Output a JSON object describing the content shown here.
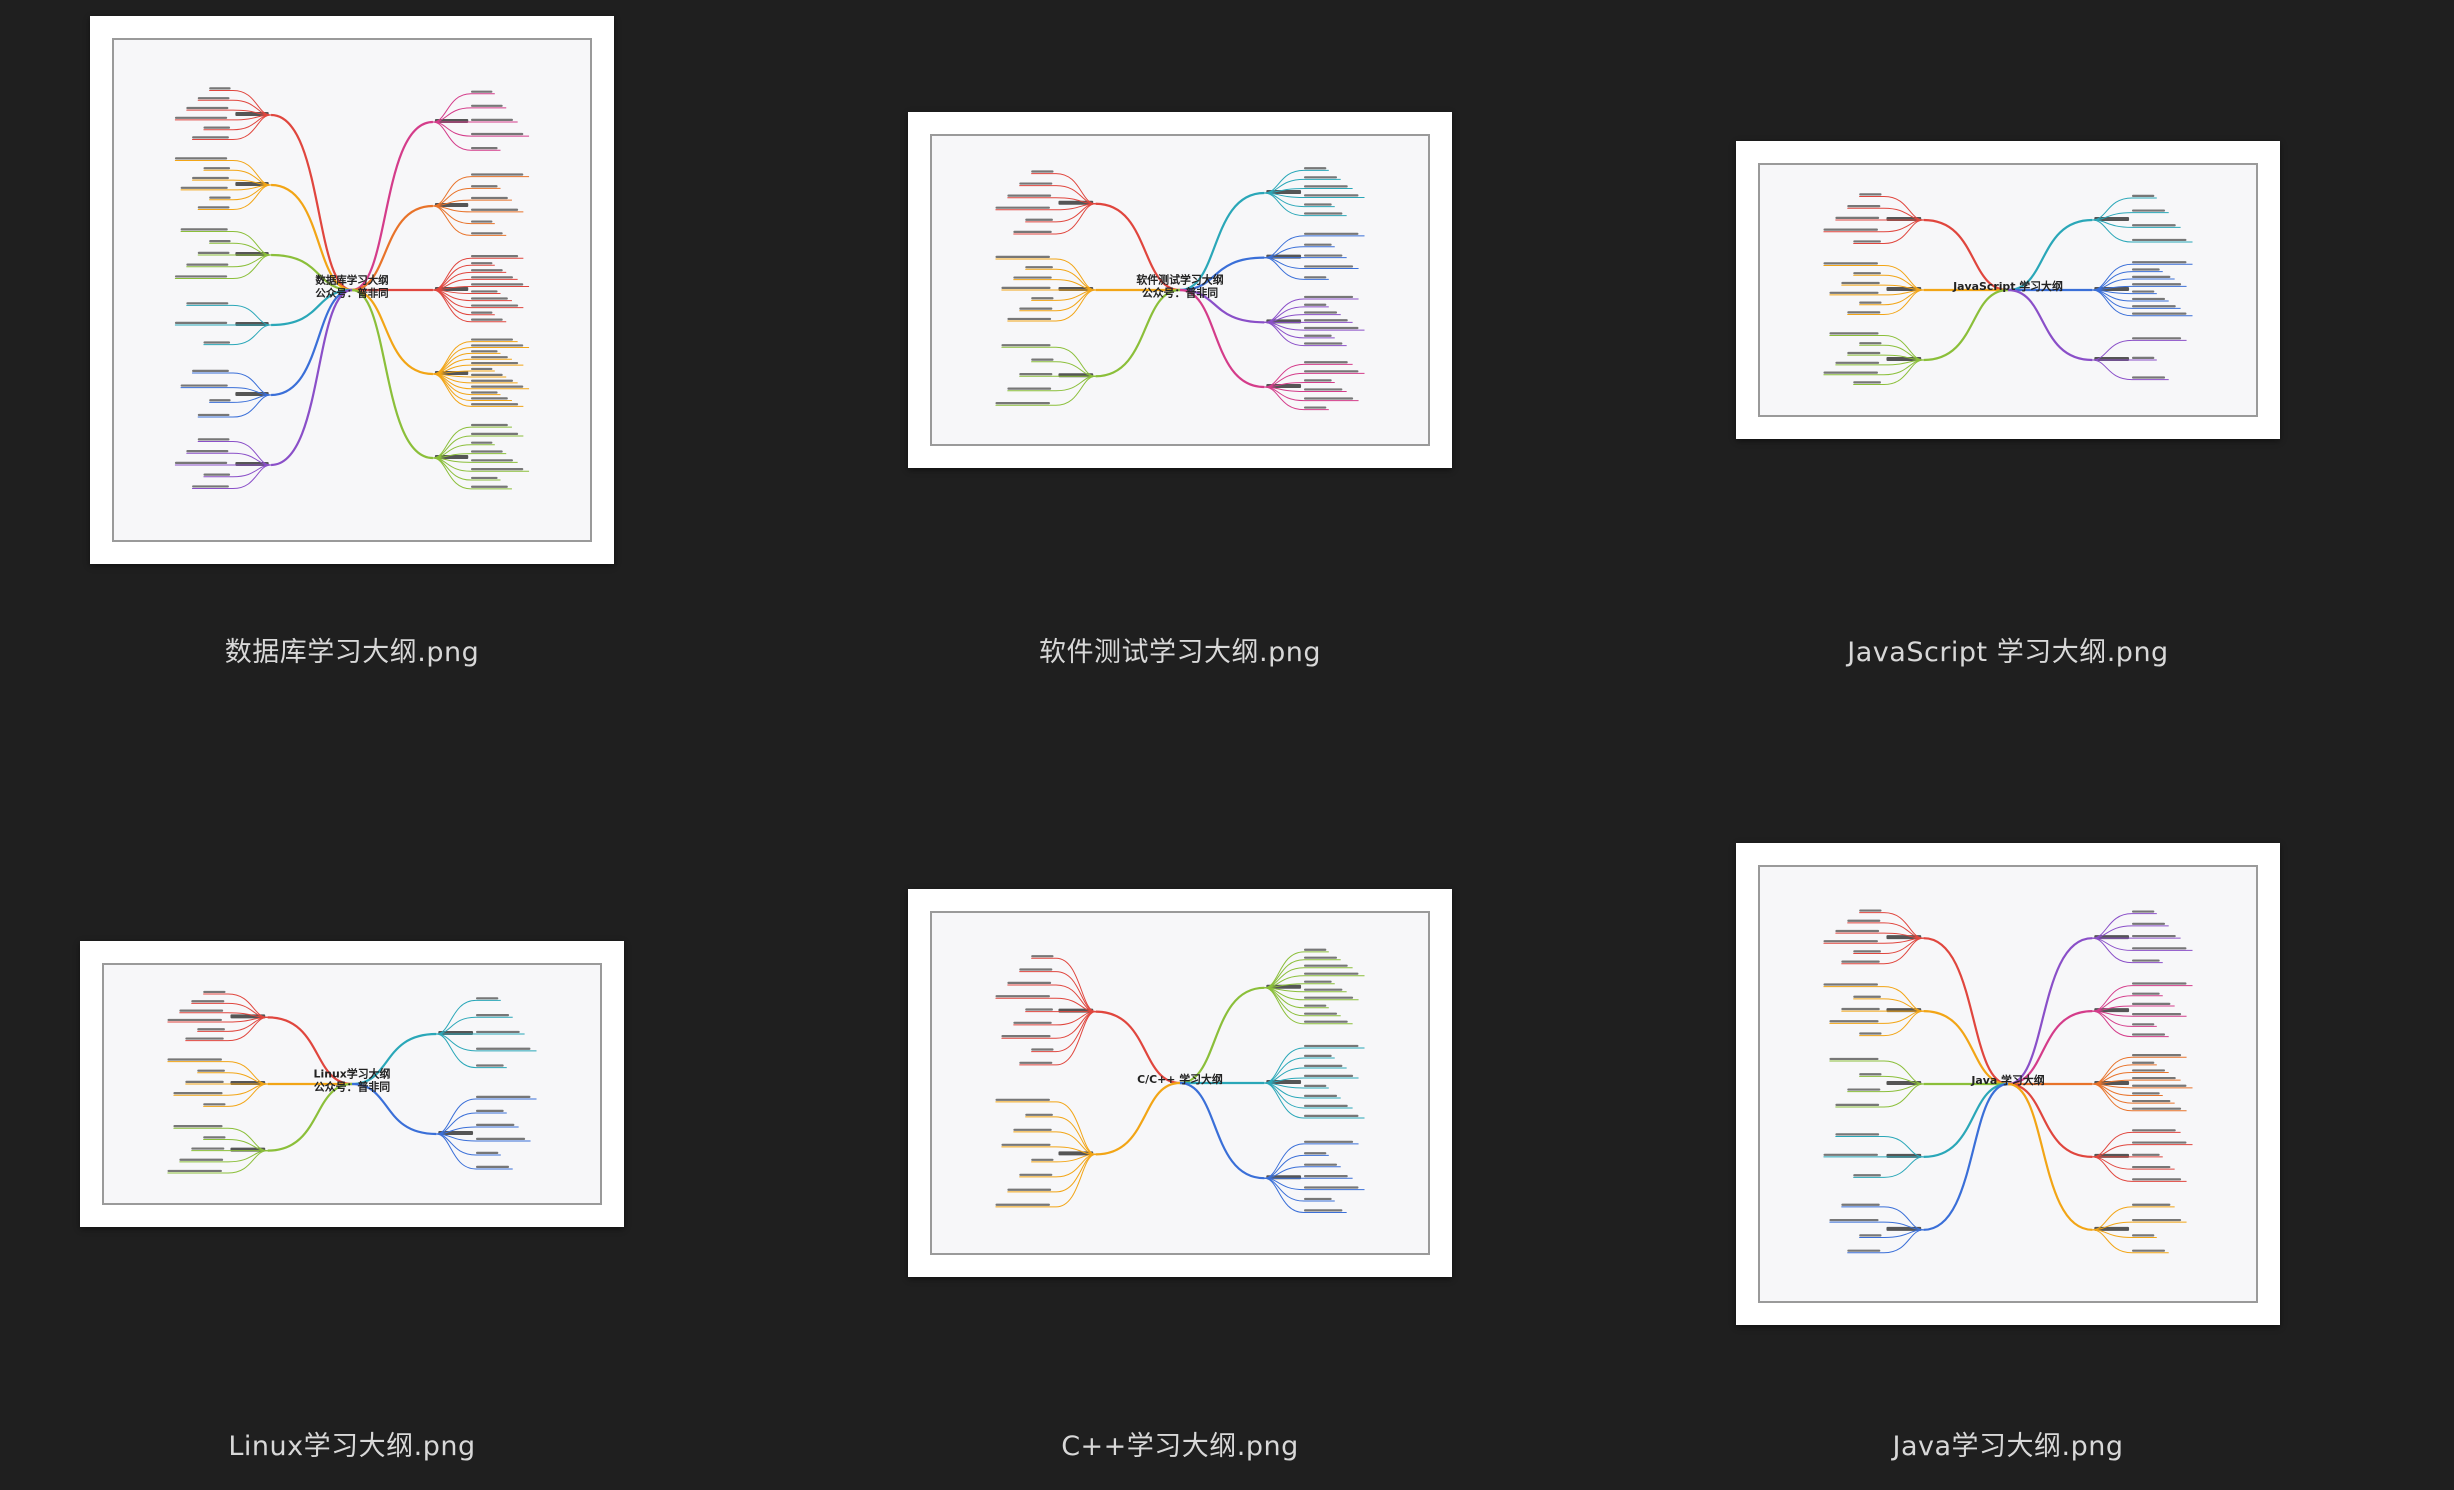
{
  "files": [
    {
      "name": "数据库学习大纲.png",
      "center": "数据库学习大纲\n公众号：普非同"
    },
    {
      "name": "软件测试学习大纲.png",
      "center": "软件测试学习大纲\n公众号：普非同"
    },
    {
      "name": "JavaScript 学习大纲.png",
      "center": "JavaScript 学习大纲"
    },
    {
      "name": "Linux学习大纲.png",
      "center": "Linux学习大纲\n公众号：普非同"
    },
    {
      "name": "C++学习大纲.png",
      "center": "C/C++ 学习大纲"
    },
    {
      "name": "Java学习大纲.png",
      "center": "Java 学习大纲"
    }
  ],
  "branch_colors": [
    "#e0463e",
    "#f2a516",
    "#8bbf3a",
    "#2aa7b8",
    "#3a6fd8",
    "#8a4fc8",
    "#d43c8a",
    "#e8732a"
  ]
}
